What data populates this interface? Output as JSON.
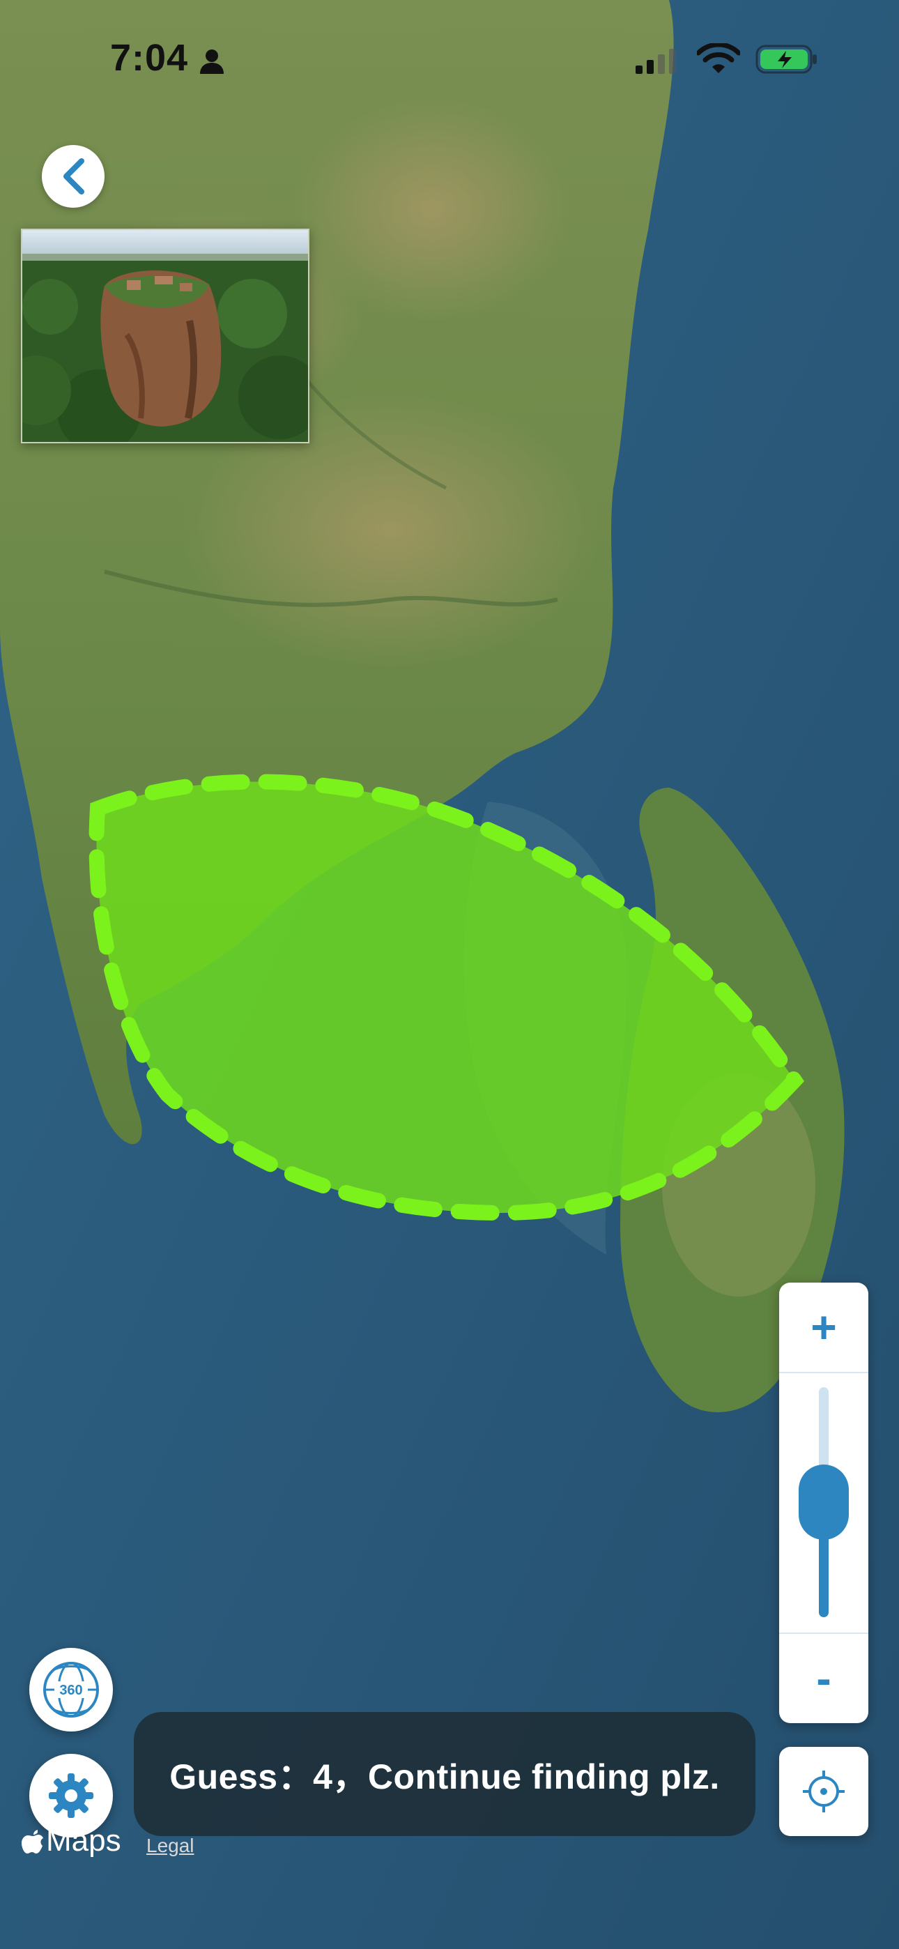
{
  "status_bar": {
    "time": "7:04"
  },
  "toast": {
    "text": "Guess：4，Continue finding plz."
  },
  "zoom": {
    "in_label": "+",
    "out_label": "-",
    "level": 0.5
  },
  "btn_360": {
    "label": "360"
  },
  "map": {
    "brand": "Maps",
    "legal_label": "Legal",
    "guess_area_color": "#6fdc1c"
  },
  "icons": {
    "back": "chevron-left-icon",
    "settings": "gear-icon",
    "locate": "crosshair-icon",
    "rotate360": "globe-360-icon",
    "battery": "battery-charging-icon"
  },
  "colors": {
    "accent": "#2e86c0",
    "battery": "#35c759",
    "guess_stroke": "#7cf21c"
  }
}
